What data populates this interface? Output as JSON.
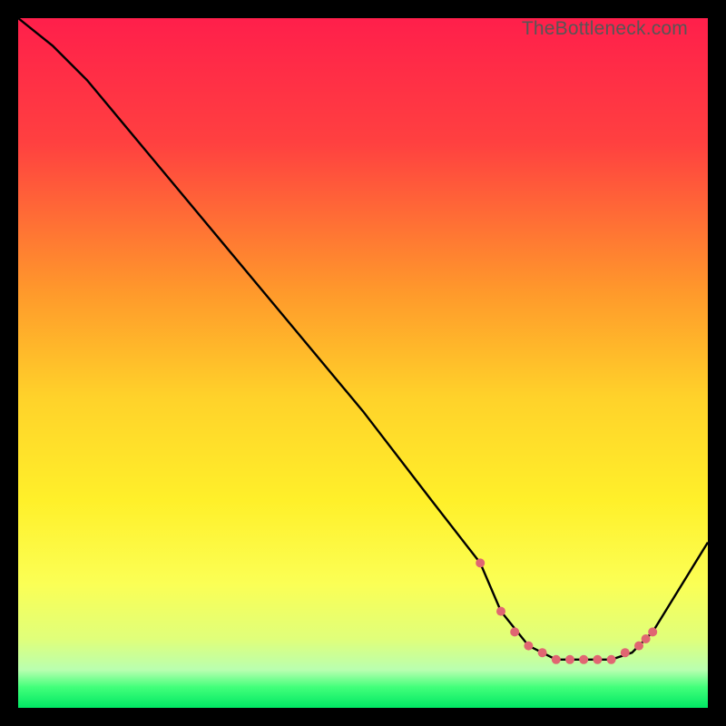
{
  "watermark": "TheBottleneck.com",
  "chart_data": {
    "type": "line",
    "title": "",
    "xlabel": "",
    "ylabel": "",
    "xlim": [
      0,
      100
    ],
    "ylim": [
      0,
      100
    ],
    "gradient_stops": [
      {
        "offset": 0,
        "color": "#ff1f4b"
      },
      {
        "offset": 0.18,
        "color": "#ff4040"
      },
      {
        "offset": 0.4,
        "color": "#ff9a2b"
      },
      {
        "offset": 0.55,
        "color": "#ffd22a"
      },
      {
        "offset": 0.7,
        "color": "#fff02a"
      },
      {
        "offset": 0.82,
        "color": "#fbff55"
      },
      {
        "offset": 0.9,
        "color": "#e0ff7a"
      },
      {
        "offset": 0.945,
        "color": "#b9ffb0"
      },
      {
        "offset": 0.97,
        "color": "#42ff7a"
      },
      {
        "offset": 1.0,
        "color": "#00e864"
      }
    ],
    "series": [
      {
        "name": "curve",
        "color": "#000000",
        "x": [
          0,
          5,
          10,
          20,
          30,
          40,
          50,
          60,
          67,
          70,
          74,
          78,
          82,
          86,
          89,
          92,
          100
        ],
        "y": [
          100,
          96,
          91,
          79,
          67,
          55,
          43,
          30,
          21,
          14,
          9,
          7,
          7,
          7,
          8,
          11,
          24
        ]
      }
    ],
    "markers": {
      "name": "dots",
      "color": "#e06672",
      "radius": 5,
      "points": [
        {
          "x": 67,
          "y": 21
        },
        {
          "x": 70,
          "y": 14
        },
        {
          "x": 72,
          "y": 11
        },
        {
          "x": 74,
          "y": 9
        },
        {
          "x": 76,
          "y": 8
        },
        {
          "x": 78,
          "y": 7
        },
        {
          "x": 80,
          "y": 7
        },
        {
          "x": 82,
          "y": 7
        },
        {
          "x": 84,
          "y": 7
        },
        {
          "x": 86,
          "y": 7
        },
        {
          "x": 88,
          "y": 8
        },
        {
          "x": 90,
          "y": 9
        },
        {
          "x": 91,
          "y": 10
        },
        {
          "x": 92,
          "y": 11
        }
      ]
    }
  }
}
